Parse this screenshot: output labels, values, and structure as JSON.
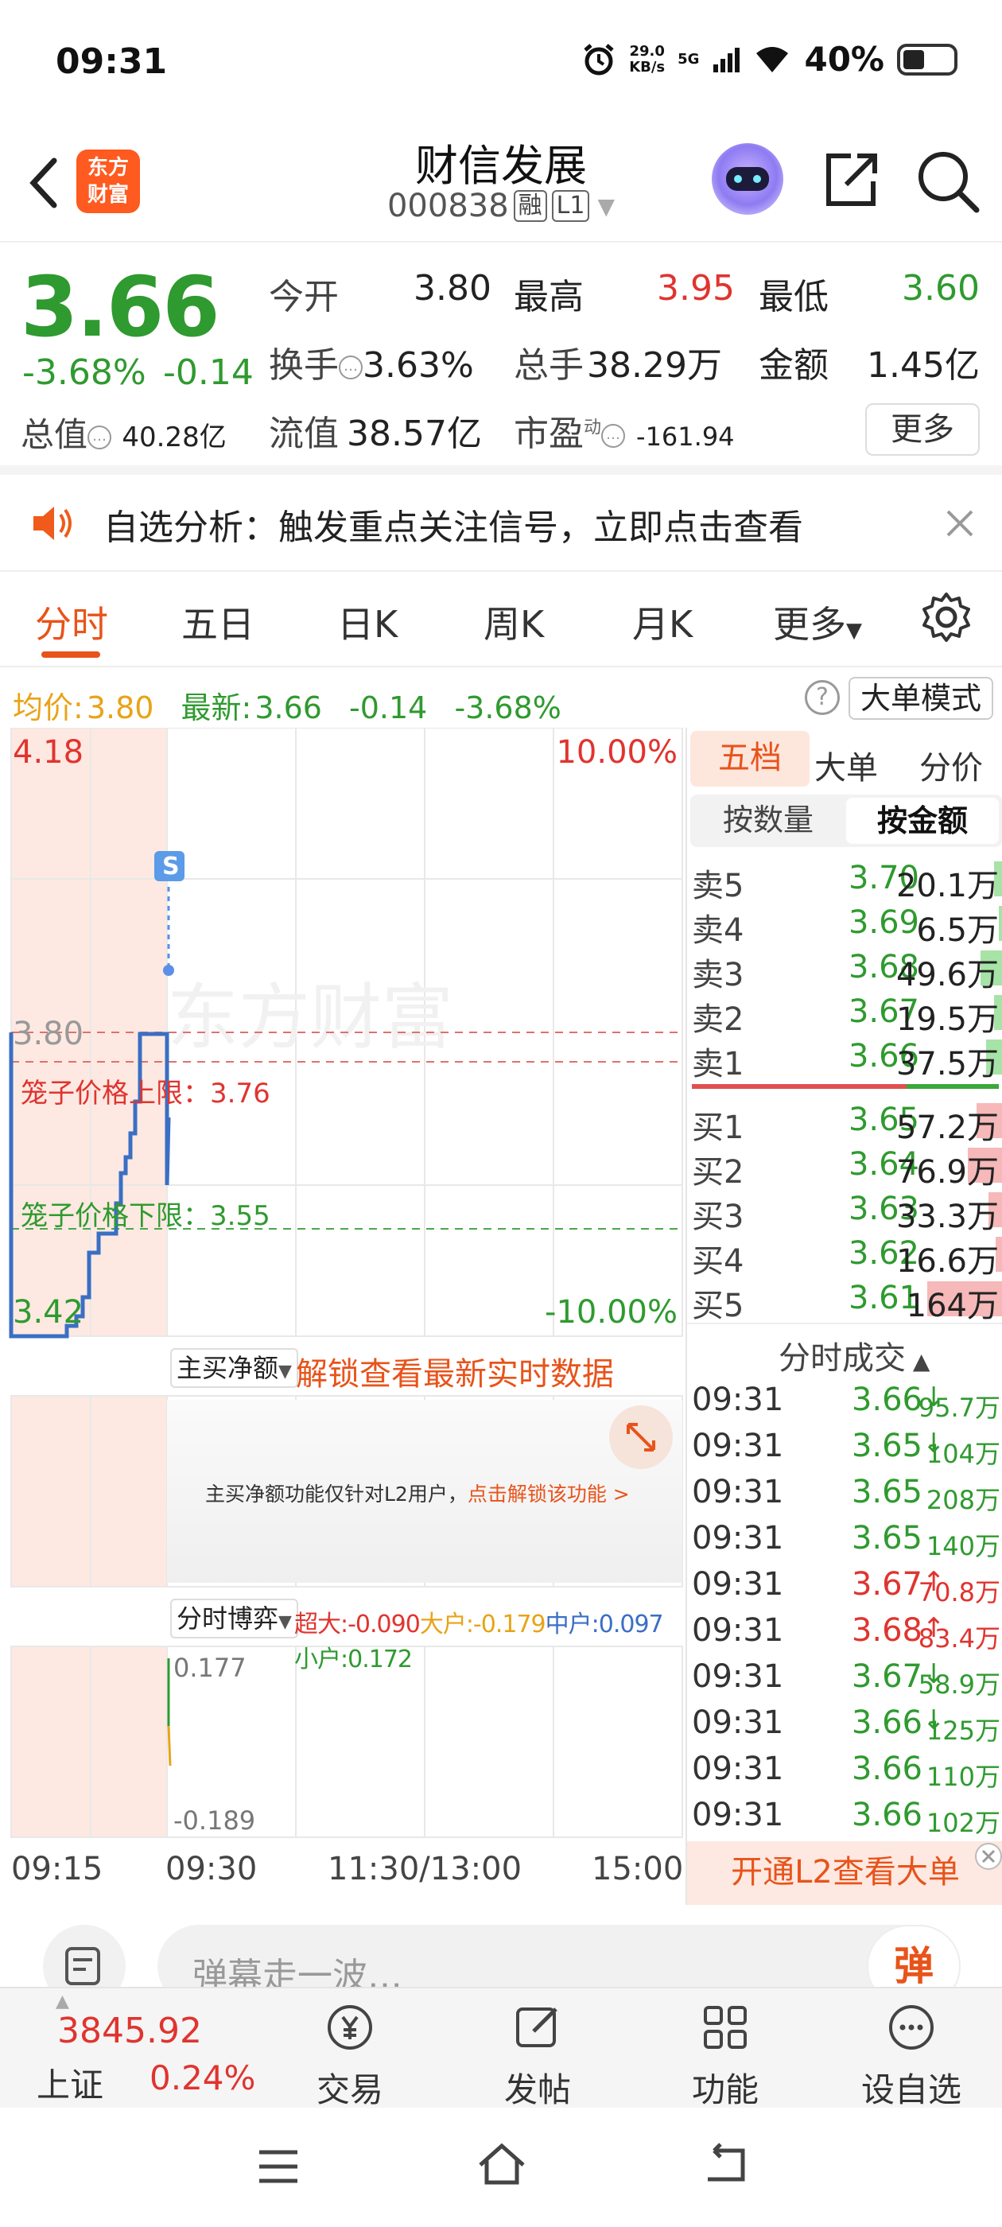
{
  "status_bar": {
    "time": "09:31",
    "net_speed_value": "29.0",
    "net_speed_unit": "KB/s",
    "network": "5G",
    "battery": "40%"
  },
  "header": {
    "stock_name": "财信发展",
    "stock_code": "000838",
    "tag_margin": "融",
    "tag_level": "L1",
    "logo_line1": "东方",
    "logo_line2": "财富"
  },
  "quote": {
    "last_price": "3.66",
    "change_pct": "-3.68%",
    "change_val": "-0.14",
    "open_label": "今开",
    "open": "3.80",
    "high_label": "最高",
    "high": "3.95",
    "low_label": "最低",
    "low": "3.60",
    "turnover_label": "换手",
    "turnover": "3.63%",
    "volume_label": "总手",
    "volume": "38.29万",
    "amount_label": "金额",
    "amount": "1.45亿",
    "total_cap_label": "总值",
    "total_cap": "40.28亿",
    "float_cap_label": "流值",
    "float_cap": "38.57亿",
    "pe_label": "市盈",
    "pe_sup": "动",
    "pe": "-161.94",
    "more_label": "更多"
  },
  "banner": {
    "text": "自选分析：触发重点关注信号，立即点击查看"
  },
  "tabs": [
    {
      "label": "分时"
    },
    {
      "label": "五日"
    },
    {
      "label": "日K"
    },
    {
      "label": "周K"
    },
    {
      "label": "月K"
    },
    {
      "label": "更多"
    }
  ],
  "avg_row": {
    "avg_label": "均价:",
    "avg_value": "3.80",
    "latest_label": "最新:",
    "latest_value": "3.66",
    "chg_val": "-0.14",
    "chg_pct": "-3.68%",
    "big_order_mode": "大单模式"
  },
  "chart": {
    "top_price": "4.18",
    "top_pct": "10.00%",
    "mid_price": "3.80",
    "bottom_price": "3.42",
    "bottom_pct": "-10.00%",
    "cage_upper": "笼子价格上限：3.76",
    "cage_lower": "笼子价格下限：3.55",
    "marker": "S",
    "watermark": "东方财富",
    "net_buy_select": "主买净额",
    "unlock_text": "解锁查看最新实时数据",
    "l2_notice": "主买净额功能仅针对L2用户，",
    "l2_notice_link": "点击解锁该功能 >",
    "game_select": "分时博弈",
    "game_super": "超大:-0.090",
    "game_large": "大户:-0.179",
    "game_mid": "中户:0.097",
    "game_small": "小户:0.172",
    "game_max": "0.177",
    "game_min": "-0.189",
    "x_labels": [
      "09:15",
      "09:30",
      "11:30/13:00",
      "15:00"
    ]
  },
  "orderbook": {
    "tabs": [
      "五档",
      "大单",
      "分价"
    ],
    "mode_tabs": [
      "按数量",
      "按金额"
    ],
    "sells": [
      {
        "label": "卖5",
        "price": "3.70",
        "vol": "20.1万",
        "bar": 0.12
      },
      {
        "label": "卖4",
        "price": "3.69",
        "vol": "6.5万",
        "bar": 0.04
      },
      {
        "label": "卖3",
        "price": "3.68",
        "vol": "49.6万",
        "bar": 0.3
      },
      {
        "label": "卖2",
        "price": "3.67",
        "vol": "19.5万",
        "bar": 0.12
      },
      {
        "label": "卖1",
        "price": "3.66",
        "vol": "37.5万",
        "bar": 0.23
      }
    ],
    "buys": [
      {
        "label": "买1",
        "price": "3.65",
        "vol": "57.2万",
        "bar": 0.35
      },
      {
        "label": "买2",
        "price": "3.64",
        "vol": "76.9万",
        "bar": 0.47
      },
      {
        "label": "买3",
        "price": "3.63",
        "vol": "33.3万",
        "bar": 0.2
      },
      {
        "label": "买4",
        "price": "3.62",
        "vol": "16.6万",
        "bar": 0.1
      },
      {
        "label": "买5",
        "price": "3.61",
        "vol": "164万",
        "bar": 1.0
      }
    ],
    "trades_title": "分时成交",
    "trades": [
      {
        "time": "09:31",
        "price": "3.66",
        "dir": "down",
        "vol": "95.7万"
      },
      {
        "time": "09:31",
        "price": "3.65",
        "dir": "down",
        "vol": "104万"
      },
      {
        "time": "09:31",
        "price": "3.65",
        "dir": "",
        "vol": "208万"
      },
      {
        "time": "09:31",
        "price": "3.65",
        "dir": "",
        "vol": "140万"
      },
      {
        "time": "09:31",
        "price": "3.67",
        "dir": "up",
        "vol": "70.8万"
      },
      {
        "time": "09:31",
        "price": "3.68",
        "dir": "up",
        "vol": "83.4万"
      },
      {
        "time": "09:31",
        "price": "3.67",
        "dir": "down",
        "vol": "58.9万"
      },
      {
        "time": "09:31",
        "price": "3.66",
        "dir": "down",
        "vol": "125万"
      },
      {
        "time": "09:31",
        "price": "3.66",
        "dir": "",
        "vol": "110万"
      },
      {
        "time": "09:31",
        "price": "3.66",
        "dir": "",
        "vol": "102万"
      }
    ],
    "l2_button": "开通L2查看大单"
  },
  "comment_bar": {
    "placeholder": "弹幕走一波…",
    "danmu_label": "弹"
  },
  "bottom_nav": {
    "index_value": "3845.92",
    "index_name": "上证",
    "index_pct": "0.24%",
    "items": [
      {
        "label": "交易"
      },
      {
        "label": "发帖"
      },
      {
        "label": "功能"
      },
      {
        "label": "设自选"
      }
    ]
  }
}
